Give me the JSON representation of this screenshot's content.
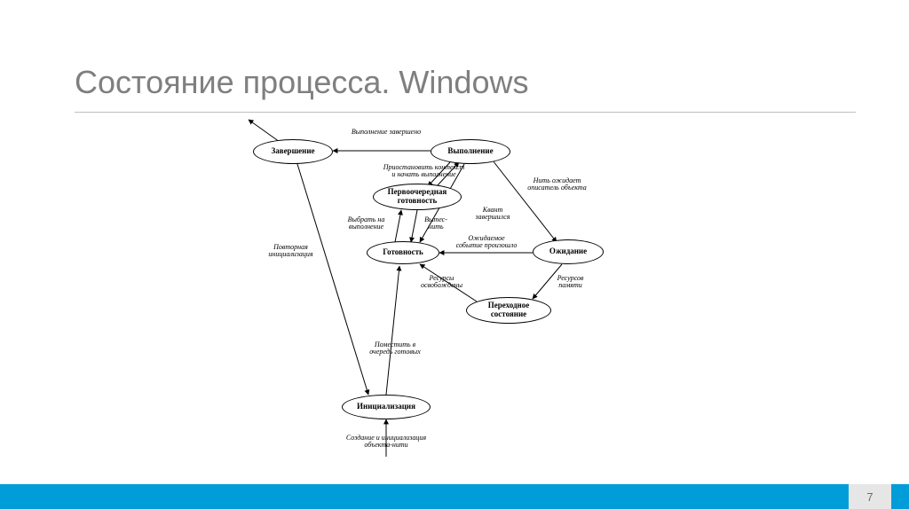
{
  "title": "Состояние процесса. Windows",
  "page_number": "7",
  "nodes": {
    "terminate": "Завершение",
    "execute": "Выполнение",
    "priority_ready": "Первоочередная готовность",
    "ready": "Готовность",
    "wait": "Ожидание",
    "transition": "Переходное состояние",
    "init": "Инициализация"
  },
  "edges": {
    "exec_terminate": "Выполнение завершено",
    "preempt": "Приостановить контекст и начать выполнение",
    "thread_waits": "Нить ожидает описатель объекта",
    "quantum_end": "Квант завершился",
    "select_exec": "Выбрать на выполнение",
    "preempt_thread": "Вытес-\nнить",
    "event_occurred": "Ожидаемое событие произошло",
    "resources_freed": "Ресурсы освобождены",
    "no_memory": "Ресурсов памяти",
    "place_queue": "Поместить в очередь готовых",
    "reinit": "Повторная инициализация",
    "create_init": "Создание и инициализация объекта-нити"
  }
}
